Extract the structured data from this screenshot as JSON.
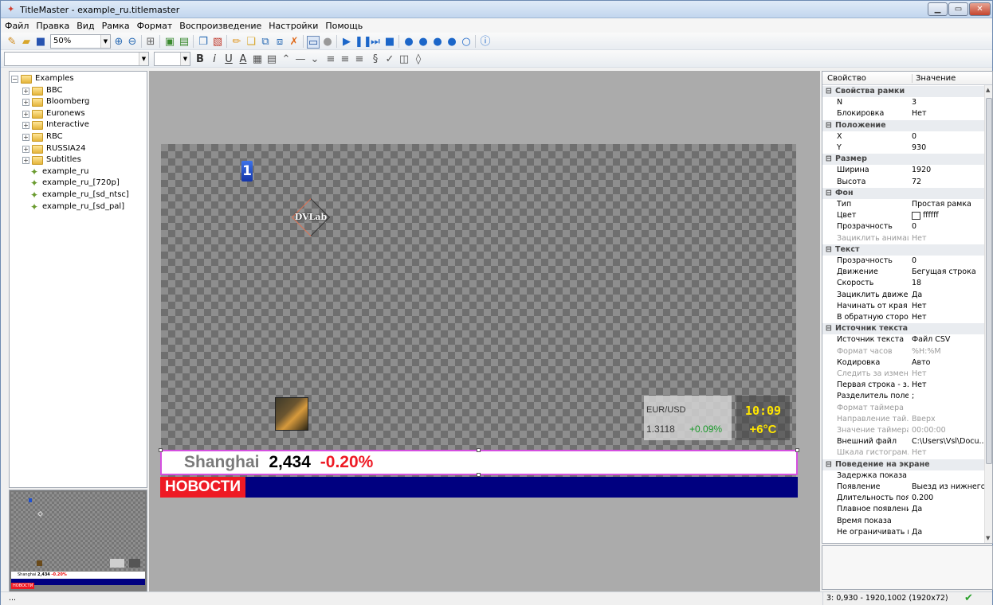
{
  "window": {
    "title": "TitleMaster - example_ru.titlemaster",
    "min": "▁",
    "max": "▭",
    "close": "✕"
  },
  "menu": [
    "Файл",
    "Правка",
    "Вид",
    "Рамка",
    "Формат",
    "Воспроизведение",
    "Настройки",
    "Помощь"
  ],
  "toolbar": {
    "zoom": "50%"
  },
  "tree": [
    {
      "label": "Examples",
      "kind": "folder",
      "depth": 0,
      "expand": "−"
    },
    {
      "label": "BBC",
      "kind": "folder",
      "depth": 1,
      "expand": "+"
    },
    {
      "label": "Bloomberg",
      "kind": "folder",
      "depth": 1,
      "expand": "+"
    },
    {
      "label": "Euronews",
      "kind": "folder",
      "depth": 1,
      "expand": "+"
    },
    {
      "label": "Interactive",
      "kind": "folder",
      "depth": 1,
      "expand": "+"
    },
    {
      "label": "RBC",
      "kind": "folder",
      "depth": 1,
      "expand": "+"
    },
    {
      "label": "RUSSIA24",
      "kind": "folder",
      "depth": 1,
      "expand": "+"
    },
    {
      "label": "Subtitles",
      "kind": "folder",
      "depth": 1,
      "expand": "+"
    },
    {
      "label": "example_ru",
      "kind": "file",
      "depth": 1,
      "expand": ""
    },
    {
      "label": "example_ru_[720p]",
      "kind": "file",
      "depth": 1,
      "expand": ""
    },
    {
      "label": "example_ru_[sd_ntsc]",
      "kind": "file",
      "depth": 1,
      "expand": ""
    },
    {
      "label": "example_ru_[sd_pal]",
      "kind": "file",
      "depth": 1,
      "expand": ""
    }
  ],
  "canvas": {
    "logo_text": "DVLab",
    "currency_label": "EUR/USD",
    "currency_value": "1.3118",
    "currency_change": "+0.09%",
    "time": "10:09",
    "temperature": "+6°C",
    "ticker_city": "Shanghai",
    "ticker_value": "2,434",
    "ticker_change": "-0.20%",
    "news_label": "НОВОСТИ"
  },
  "preview": {
    "ticker_city": "Shanghai",
    "ticker_value": "2,434",
    "ticker_change": "-0.20%",
    "news_label": "НОВОСТИ"
  },
  "properties": {
    "col_property": "Свойство",
    "col_value": "Значение",
    "rows": [
      {
        "k": "Свойства рамки",
        "v": "",
        "type": "cat"
      },
      {
        "k": "N",
        "v": "3",
        "type": "row"
      },
      {
        "k": "Блокировка",
        "v": "Нет",
        "type": "row"
      },
      {
        "k": "Положение",
        "v": "",
        "type": "cat"
      },
      {
        "k": "X",
        "v": "0",
        "type": "row"
      },
      {
        "k": "Y",
        "v": "930",
        "type": "row"
      },
      {
        "k": "Размер",
        "v": "",
        "type": "cat"
      },
      {
        "k": "Ширина",
        "v": "1920",
        "type": "row"
      },
      {
        "k": "Высота",
        "v": "72",
        "type": "row"
      },
      {
        "k": "Фон",
        "v": "",
        "type": "cat"
      },
      {
        "k": "Тип",
        "v": "Простая рамка",
        "type": "row"
      },
      {
        "k": "Цвет",
        "v": "ffffff",
        "type": "color"
      },
      {
        "k": "Прозрачность",
        "v": "0",
        "type": "row"
      },
      {
        "k": "Зациклить анимац...",
        "v": "Нет",
        "type": "dis"
      },
      {
        "k": "Текст",
        "v": "",
        "type": "cat"
      },
      {
        "k": "Прозрачность",
        "v": "0",
        "type": "row"
      },
      {
        "k": "Движение",
        "v": "Бегущая строка",
        "type": "row"
      },
      {
        "k": "Скорость",
        "v": "18",
        "type": "row"
      },
      {
        "k": "Зациклить движен...",
        "v": "Да",
        "type": "row"
      },
      {
        "k": "Начинать от края ...",
        "v": "Нет",
        "type": "row"
      },
      {
        "k": "В обратную сторону",
        "v": "Нет",
        "type": "row"
      },
      {
        "k": "Источник текста",
        "v": "",
        "type": "cat"
      },
      {
        "k": "Источник текста",
        "v": "Файл CSV",
        "type": "row"
      },
      {
        "k": "Формат часов",
        "v": "%H:%M",
        "type": "dis"
      },
      {
        "k": "Кодировка",
        "v": "Авто",
        "type": "row"
      },
      {
        "k": "Следить за измен...",
        "v": "Нет",
        "type": "dis"
      },
      {
        "k": "Первая строка - з...",
        "v": "Нет",
        "type": "row"
      },
      {
        "k": "Разделитель полей",
        "v": ";",
        "type": "row"
      },
      {
        "k": "Формат таймера",
        "v": "",
        "type": "dis"
      },
      {
        "k": "Направление тай...",
        "v": "Вверх",
        "type": "dis"
      },
      {
        "k": "Значение таймера",
        "v": "00:00:00",
        "type": "dis"
      },
      {
        "k": "Внешний файл",
        "v": "C:\\Users\\Vsl\\Docu...",
        "type": "row"
      },
      {
        "k": "Шкала гистограм...",
        "v": "Нет",
        "type": "dis"
      },
      {
        "k": "Поведение на экране",
        "v": "",
        "type": "cat"
      },
      {
        "k": "Задержка показа",
        "v": "",
        "type": "row"
      },
      {
        "k": "Появление",
        "v": "Выезд из нижнего...",
        "type": "row"
      },
      {
        "k": "Длительность поя...",
        "v": "0.200",
        "type": "row"
      },
      {
        "k": "Плавное появление",
        "v": "Да",
        "type": "row"
      },
      {
        "k": "Время показа",
        "v": "",
        "type": "row"
      },
      {
        "k": "Не ограничивать в...",
        "v": "Да",
        "type": "row"
      }
    ]
  },
  "status": {
    "left": "...",
    "position": "3: 0,930 - 1920,1002 (1920x72)",
    "ok": "✔"
  }
}
